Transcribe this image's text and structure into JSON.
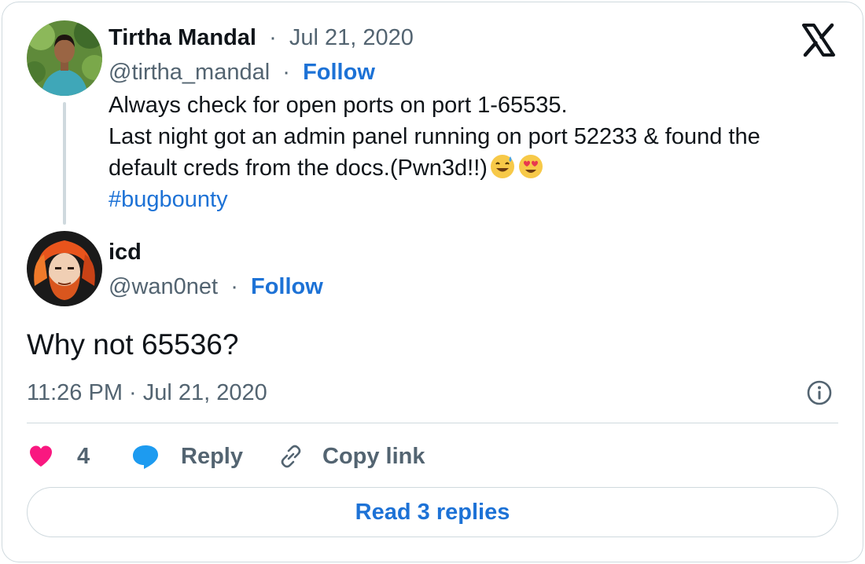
{
  "quoted_tweet": {
    "author_name": "Tirtha Mandal",
    "separator": "·",
    "date": "Jul 21, 2020",
    "handle": "@tirtha_mandal",
    "follow_label": "Follow",
    "text_lines": [
      "Always check for open ports on port 1-65535.",
      "Last night got an admin panel running on port 52233 & found the",
      "default creds from the docs.(Pwn3d!!)"
    ],
    "emojis": [
      "sweat-smile-emoji",
      "heart-eyes-emoji"
    ],
    "hashtag": "#bugbounty",
    "avatar_icon": "avatar-photo"
  },
  "reply_tweet": {
    "author_name": "icd",
    "handle": "@wan0net",
    "separator": "·",
    "follow_label": "Follow",
    "text": "Why not 65536?",
    "timestamp": "11:26 PM · Jul 21, 2020",
    "avatar_icon": "avatar-illustration"
  },
  "actions": {
    "like_count": "4",
    "reply_label": "Reply",
    "copy_link_label": "Copy link",
    "like_icon": "heart-icon",
    "reply_icon": "speech-bubble-icon",
    "copy_icon": "link-icon"
  },
  "read_replies_label": "Read 3 replies",
  "logo_icon": "x-logo-icon",
  "info_icon": "info-icon",
  "colors": {
    "accent": "#1d72d6",
    "like": "#f91880",
    "muted": "#536471",
    "border": "#cfd9de"
  }
}
